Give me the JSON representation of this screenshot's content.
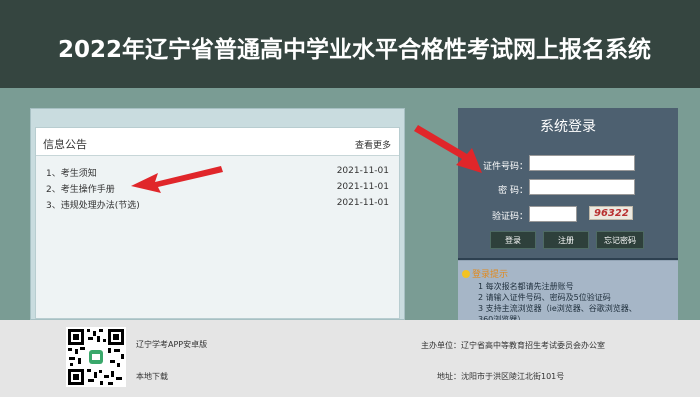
{
  "header": {
    "title": "2022年辽宁省普通高中学业水平合格性考试网上报名系统"
  },
  "notice": {
    "title": "信息公告",
    "more_label": "查看更多",
    "items": [
      {
        "label": "1、考生须知",
        "date": "2021-11-01"
      },
      {
        "label": "2、考生操作手册",
        "date": "2021-11-01"
      },
      {
        "label": "3、违规处理办法(节选)",
        "date": "2021-11-01"
      }
    ]
  },
  "login": {
    "title": "系统登录",
    "id_label": "证件号码：",
    "password_label": "密  码：",
    "captcha_label": "验证码：",
    "captcha_text": "96322",
    "buttons": {
      "login": "登录",
      "register": "注册",
      "forgot": "忘记密码"
    }
  },
  "tips": {
    "title": "登录提示",
    "lines": [
      "1 每次报名都请先注册账号",
      "2 请输入证件号码、密码及5位验证码",
      "3 支持主流浏览器（ie浏览器、谷歌浏览器、",
      "360浏览器）"
    ]
  },
  "footer": {
    "qr_caption": "辽宁学考APP安卓版",
    "download_label": "本地下载",
    "sponsor_label": "主办单位：",
    "sponsor_value": "辽宁省高中等教育招生考试委员会办公室",
    "address_label": "地址：",
    "address_value": "沈阳市于洪区陵江北街101号"
  },
  "colors": {
    "header_bg": "#354540",
    "band_bg": "#7a9c94",
    "login_bg": "#4d6070",
    "annotation_arrow": "#e0262a"
  }
}
